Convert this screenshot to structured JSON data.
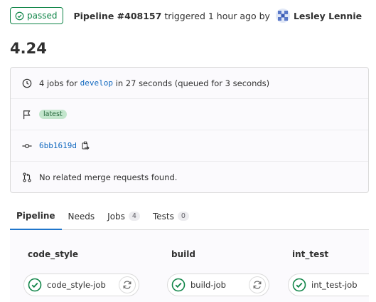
{
  "header": {
    "status": "passed",
    "pipeline": "Pipeline #408157",
    "triggered": "triggered 1 hour ago by",
    "author": "Lesley Lennie"
  },
  "page_title": "4.24",
  "info": {
    "jobs_prefix": "4 jobs for",
    "branch": "develop",
    "jobs_suffix": "in 27 seconds (queued for 3 seconds)",
    "tag": "latest",
    "commit": "6bb1619d",
    "merge_requests": "No related merge requests found."
  },
  "tabs": [
    {
      "label": "Pipeline",
      "active": true
    },
    {
      "label": "Needs"
    },
    {
      "label": "Jobs",
      "count": "4"
    },
    {
      "label": "Tests",
      "count": "0"
    }
  ],
  "stages": [
    {
      "name": "code_style",
      "job": "code_style-job"
    },
    {
      "name": "build",
      "job": "build-job"
    },
    {
      "name": "int_test",
      "job": "int_test-job"
    }
  ],
  "colors": {
    "success": "#108548",
    "link": "#1068bf",
    "active_tab": "#1f75cb"
  },
  "icons": [
    "check-circle-icon",
    "clock-icon",
    "flag-icon",
    "commit-icon",
    "copy-icon",
    "merge-request-icon",
    "retry-icon"
  ]
}
